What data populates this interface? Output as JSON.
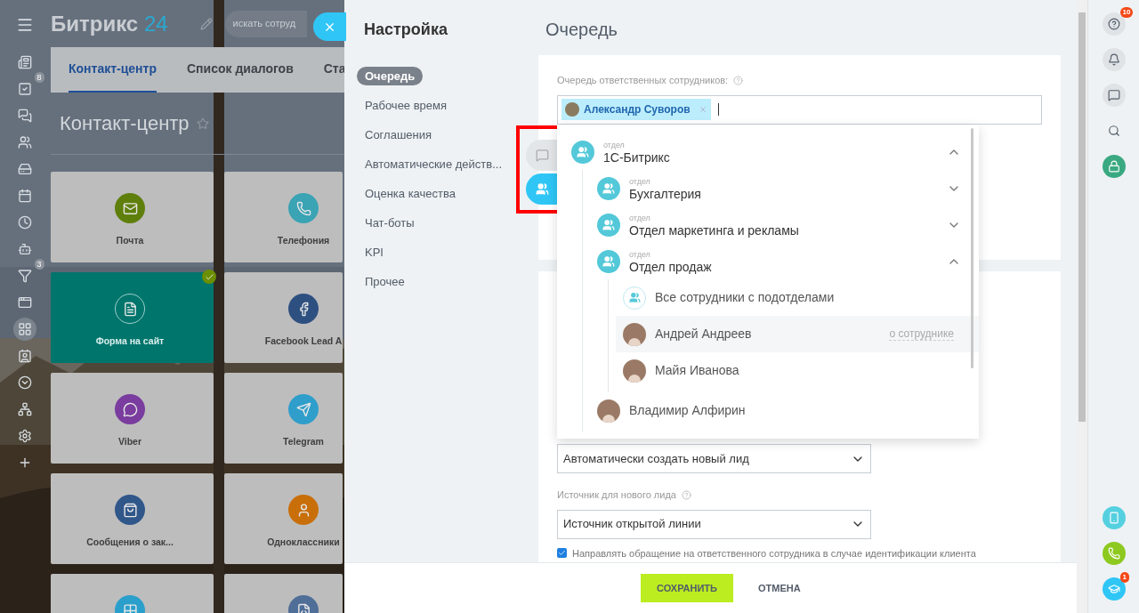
{
  "background": {
    "logo": {
      "name": "Битрикс",
      "accent": "24"
    },
    "search": {
      "placeholder": "искать сотруд"
    },
    "left_rail": [
      {
        "kind": "news",
        "selected": false
      },
      {
        "kind": "tasks",
        "badge": "8",
        "selected": false
      },
      {
        "kind": "chat",
        "selected": false
      },
      {
        "kind": "groups",
        "selected": false
      },
      {
        "kind": "drive",
        "selected": false
      },
      {
        "kind": "calendar",
        "selected": false
      },
      {
        "kind": "time",
        "selected": false
      },
      {
        "kind": "bot",
        "selected": false
      },
      {
        "kind": "funnel",
        "badge": "3",
        "selected": false
      },
      {
        "kind": "window",
        "selected": false
      },
      {
        "kind": "apps",
        "selected": true
      },
      {
        "kind": "contact",
        "selected": false
      },
      {
        "kind": "more",
        "selected": false
      },
      {
        "kind": "network",
        "selected": false
      },
      {
        "kind": "settings",
        "selected": false
      },
      {
        "kind": "plus",
        "selected": false
      }
    ],
    "tabs": [
      {
        "label": "Контакт-центр",
        "selected": true
      },
      {
        "label": "Список диалогов",
        "selected": false
      },
      {
        "label": "Ста",
        "selected": false
      }
    ],
    "title": "Контакт-центр",
    "tiles": [
      {
        "kind": "mail",
        "label": "Почта",
        "color": "#5f7f0c",
        "selected": false
      },
      {
        "kind": "phone",
        "label": "Телефония",
        "color": "#3aa3b4",
        "selected": false
      },
      {
        "kind": "form",
        "label": "Форма на сайт",
        "color": "#00756c",
        "selected": true
      },
      {
        "kind": "facebook",
        "label": "Facebook Lead A",
        "color": "#2d5080",
        "selected": false
      },
      {
        "kind": "viber",
        "label": "Viber",
        "color": "#7a3c9e",
        "selected": false
      },
      {
        "kind": "telegram",
        "label": "Telegram",
        "color": "#2f9ecb",
        "selected": false
      },
      {
        "kind": "vk",
        "label": "Сообщения о зак...",
        "color": "#30578a",
        "selected": false
      },
      {
        "kind": "ok",
        "label": "Одноклассники",
        "color": "#c96f0a",
        "selected": false
      },
      {
        "kind": "grid",
        "color": "#2a9fcb",
        "selected": false
      },
      {
        "kind": "doc",
        "color": "#4f6e98",
        "selected": false
      }
    ]
  },
  "panel": {
    "title": "Настройка",
    "nav": [
      {
        "label": "Очередь",
        "selected": true
      },
      {
        "label": "Рабочее время",
        "selected": false
      },
      {
        "label": "Соглашения",
        "selected": false
      },
      {
        "label": "Автоматические действ...",
        "selected": false
      },
      {
        "label": "Оценка качества",
        "selected": false
      },
      {
        "label": "Чат-боты",
        "selected": false
      },
      {
        "label": "KPI",
        "selected": false
      },
      {
        "label": "Прочее",
        "selected": false
      }
    ],
    "heading": "Очередь",
    "queue_field": {
      "label": "Очередь ответственных сотрудников:",
      "tags": [
        {
          "name": "Александр Суворов"
        }
      ]
    },
    "selector_tabs": [
      {
        "kind": "chats",
        "selected": false
      },
      {
        "kind": "departments",
        "selected": true
      }
    ],
    "annotation_frame": true,
    "tree": [
      {
        "kind": "department",
        "caption": "отдел",
        "name": "1С-Битрикс",
        "expanded": true,
        "children": [
          {
            "kind": "department",
            "caption": "отдел",
            "name": "Бухгалтерия",
            "expanded": false
          },
          {
            "kind": "department",
            "caption": "отдел",
            "name": "Отдел маркетинга и рекламы",
            "expanded": false
          },
          {
            "kind": "department",
            "caption": "отдел",
            "name": "Отдел продаж",
            "expanded": true,
            "children": [
              {
                "kind": "all",
                "name": "Все сотрудники с подотделами"
              },
              {
                "kind": "user",
                "name": "Андрей Андреев",
                "hovered": true,
                "link": "о сотруднике"
              },
              {
                "kind": "user",
                "name": "Майя Иванова",
                "hovered": false
              }
            ]
          },
          {
            "kind": "user",
            "name": "Владимир Алфирин",
            "hovered": false
          }
        ]
      }
    ],
    "lead_select": {
      "value": "Автоматически создать новый лид"
    },
    "source_label": "Источник для нового лида",
    "source_select": {
      "value": "Источник открытой линии"
    },
    "redirect_checkbox": {
      "label": "Направлять обращение на ответственного сотрудника в случае идентификации клиента",
      "checked": true
    },
    "buttons": [
      {
        "kind": "primary",
        "label": "СОХРАНИТЬ"
      },
      {
        "kind": "plain",
        "label": "ОТМЕНА"
      }
    ]
  },
  "right_rail": [
    {
      "kind": "help",
      "badge": "10"
    },
    {
      "kind": "bell"
    },
    {
      "kind": "chat"
    },
    {
      "kind": "search"
    },
    {
      "kind": "lock"
    },
    {
      "kind": "gap"
    },
    {
      "kind": "cloud-phone"
    },
    {
      "kind": "call"
    },
    {
      "kind": "learn",
      "badge": "1"
    }
  ]
}
